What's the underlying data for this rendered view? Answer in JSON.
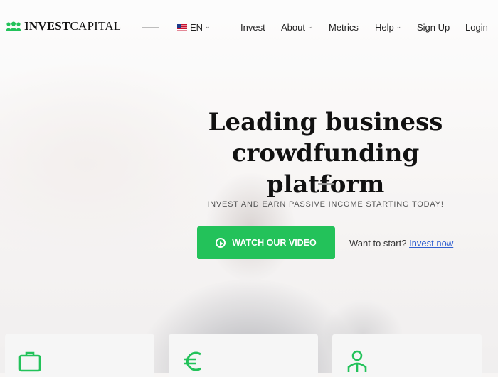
{
  "brand": {
    "name_strong": "INVEST",
    "name_light": "CAPITAL"
  },
  "language": {
    "code": "EN"
  },
  "nav": {
    "invest": "Invest",
    "about": "About",
    "metrics": "Metrics",
    "help": "Help",
    "signup": "Sign Up",
    "login": "Login"
  },
  "hero": {
    "headline_line1": "Leading business",
    "headline_line2": "crowdfunding platform",
    "tagline": "INVEST AND EARN PASSIVE INCOME STARTING TODAY!",
    "cta_label": "WATCH OUR VIDEO",
    "start_text": "Want to start?",
    "start_link": "Invest now"
  },
  "cards": [
    {
      "icon": "briefcase-icon"
    },
    {
      "icon": "euro-icon"
    },
    {
      "icon": "investor-icon"
    }
  ],
  "colors": {
    "accent": "#23c25a",
    "link": "#2f5fd0"
  }
}
